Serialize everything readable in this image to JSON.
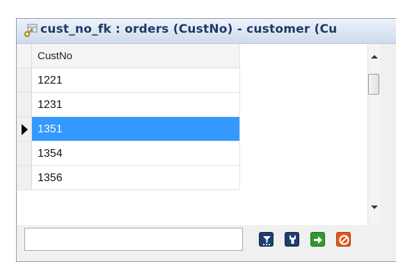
{
  "window": {
    "title": "cust_no_fk : orders (CustNo) - customer (Cu",
    "title_icon": "relation-key-icon"
  },
  "grid": {
    "column_header": "CustNo",
    "rows": [
      {
        "value": "1221",
        "selected": false
      },
      {
        "value": "1231",
        "selected": false
      },
      {
        "value": "1351",
        "selected": true
      },
      {
        "value": "1354",
        "selected": false
      },
      {
        "value": "1356",
        "selected": false
      }
    ],
    "selection_color": "#3399ff"
  },
  "footer": {
    "filter_value": "",
    "filter_placeholder": "",
    "buttons": [
      {
        "name": "filter-button",
        "icon": "filter-icon"
      },
      {
        "name": "key-button",
        "icon": "key-icon"
      },
      {
        "name": "ok-button",
        "icon": "arrow-right-icon"
      },
      {
        "name": "cancel-button",
        "icon": "cancel-icon"
      }
    ]
  }
}
